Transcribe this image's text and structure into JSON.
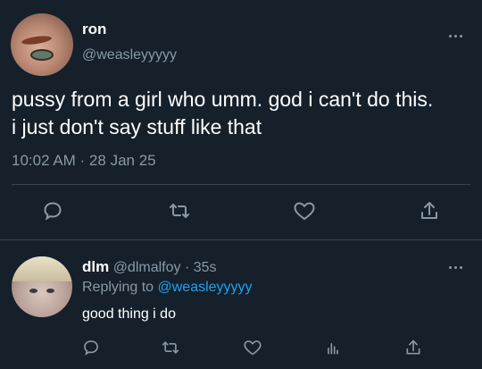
{
  "tweet": {
    "author_name": "ron",
    "author_handle": "@weasleyyyyy",
    "text_line1": "pussy from a girl who umm. god i can't do this.",
    "text_line2": "i just don't say stuff like that",
    "timestamp": "10:02 AM · 28 Jan 25",
    "more_icon": "more-horizontal-icon",
    "actions": [
      "reply-icon",
      "retweet-icon",
      "like-icon",
      "share-icon"
    ]
  },
  "reply": {
    "author_name": "dlm",
    "author_handle": "@dlmalfoy",
    "separator": "·",
    "age": "35s",
    "replying_to_label": "Replying to",
    "replying_to_handle": "@weasleyyyyy",
    "text": "good thing i do",
    "more_icon": "more-horizontal-icon",
    "actions": [
      "reply-icon",
      "retweet-icon",
      "like-icon",
      "analytics-icon",
      "share-icon"
    ]
  },
  "colors": {
    "background": "#15202b",
    "secondary_text": "#8899a6",
    "link": "#1da1f2",
    "divider": "#38444d"
  }
}
